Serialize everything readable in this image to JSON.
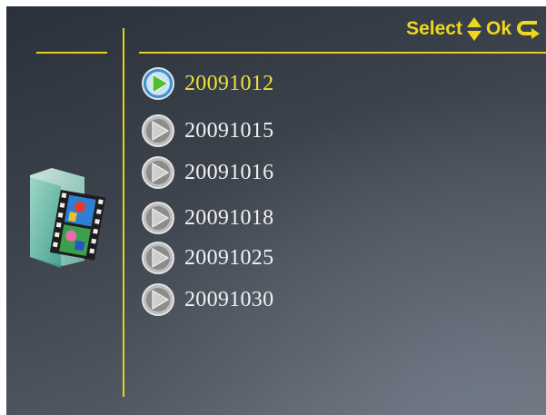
{
  "header": {
    "select_label": "Select",
    "ok_label": "Ok",
    "updown_icon": "up-down-arrows-icon",
    "return_icon": "return-arrow-icon"
  },
  "sidebar": {
    "icon": "video-folder-icon"
  },
  "files": [
    {
      "label": "20091012",
      "selected": true
    },
    {
      "label": "20091015",
      "selected": false
    },
    {
      "label": "20091016",
      "selected": false
    },
    {
      "label": "20091018",
      "selected": false
    },
    {
      "label": "20091025",
      "selected": false
    },
    {
      "label": "20091030",
      "selected": false
    }
  ],
  "colors": {
    "accent": "#f2d81c",
    "selected_text": "#f2e23a",
    "text": "#f4f4f4",
    "selected_icon": "#4aa8e8",
    "idle_icon": "#c8c8c8"
  }
}
